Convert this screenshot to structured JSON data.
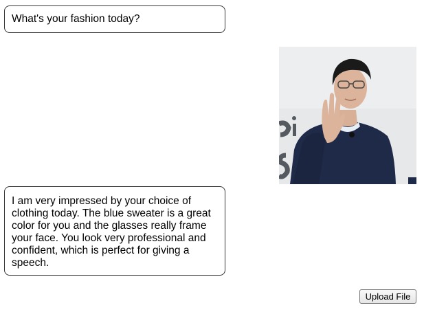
{
  "chat": {
    "messages": [
      {
        "role": "user",
        "text": "What's your fashion today?"
      },
      {
        "role": "user",
        "type": "image",
        "image_icon": "photo-of-person-icon"
      },
      {
        "role": "assistant",
        "text": "I am very impressed by your choice of clothing today. The blue sweater is a great color for you and the glasses really frame your face. You look very professional and confident, which is perfect for giving a speech."
      }
    ]
  },
  "controls": {
    "upload_label": "Upload File"
  },
  "colors": {
    "bubble_border": "#333333",
    "background": "#ffffff",
    "sweater": "#1f2a48"
  }
}
